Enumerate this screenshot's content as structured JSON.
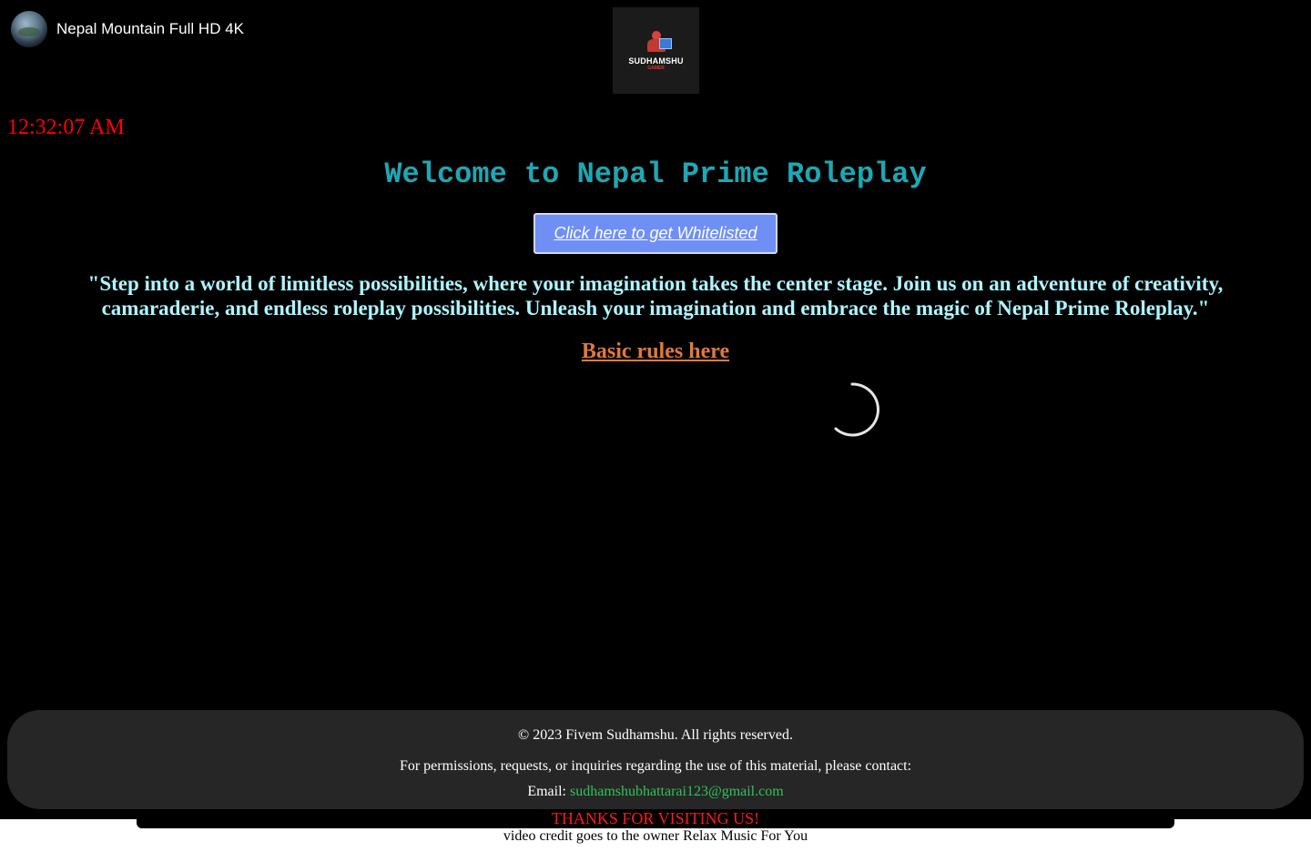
{
  "video": {
    "title": "Nepal Mountain Full HD 4K",
    "channel_avatar_icon": "globe-icon"
  },
  "logo": {
    "name": "SUDHAMSHU",
    "subtitle": "GAMER"
  },
  "clock": {
    "time": "12:32:07 AM"
  },
  "hero": {
    "heading": "Welcome to Nepal Prime Roleplay",
    "whitelist_button": "Click here to get Whitelisted",
    "tagline": "\"Step into a world of limitless possibilities, where your imagination takes the center stage. Join us on an adventure of creativity, camaraderie, and endless roleplay possibilities. Unleash your imagination and embrace the magic of Nepal Prime Roleplay.\"",
    "rules_link": "Basic rules here"
  },
  "footer": {
    "copyright": "© 2023 Fivem Sudhamshu. All rights reserved.",
    "permissions": "For permissions, requests, or inquiries regarding the use of this material, please contact:",
    "email_label": "Email:",
    "email": "sudhamshubhattarai123@gmail.com",
    "thanks": "THANKS FOR VISITING US!",
    "credit": "video credit goes to the owner Relax Music For You"
  },
  "colors": {
    "background": "#000000",
    "clock": "#ff0000",
    "heading": "#1fa7b4",
    "button": "#6f8ff5",
    "tagline": "#aef6ff",
    "rules_link": "#e0793a",
    "footer_bg": "#262626",
    "email_link": "#2fc25b",
    "thanks": "#ff1a1a"
  }
}
